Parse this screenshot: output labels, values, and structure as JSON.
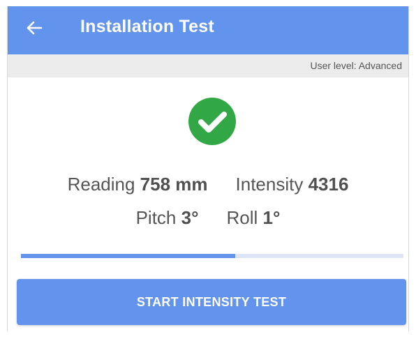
{
  "header": {
    "title": "Installation Test",
    "back_icon": "arrow-left-icon",
    "background_color": "#6294ee"
  },
  "user_level": "User level: Advanced",
  "status": {
    "icon": "check-circle-icon",
    "color": "#31a845"
  },
  "readings": {
    "reading_label": "Reading",
    "reading_value": "758 mm",
    "intensity_label": "Intensity",
    "intensity_value": "4316",
    "pitch_label": "Pitch",
    "pitch_value": "3°",
    "roll_label": "Roll",
    "roll_value": "1°"
  },
  "progress": {
    "fraction": 0.56
  },
  "actions": {
    "start_label": "START INTENSITY TEST"
  }
}
